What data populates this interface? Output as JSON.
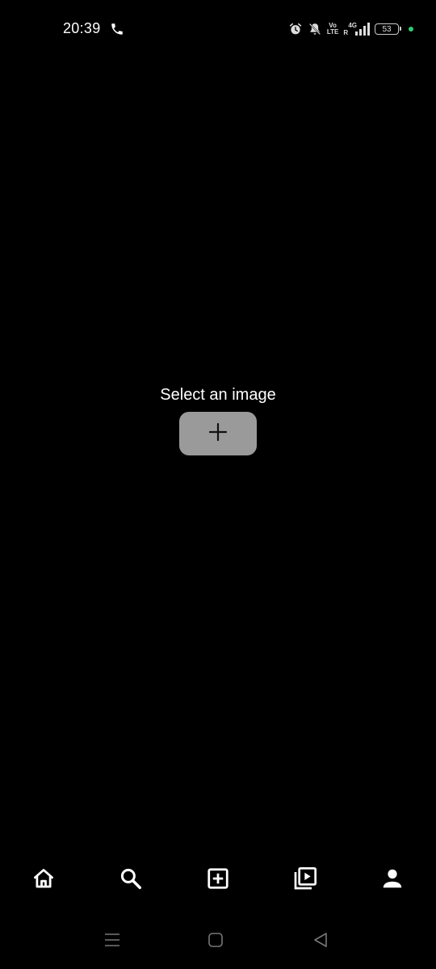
{
  "status_bar": {
    "time": "20:39",
    "volte_top": "Vo",
    "volte_bottom": "LTE",
    "network_top": "4G",
    "network_bottom": "R",
    "battery_level": "53",
    "icons": [
      "call-icon",
      "alarm-icon",
      "bell-off-icon",
      "signal-icon",
      "battery-icon"
    ],
    "dot_color": "#2ecc71"
  },
  "main": {
    "prompt": "Select an image",
    "add_button_icon": "plus-icon",
    "add_button_color": "#9a9a9a"
  },
  "bottom_nav": {
    "items": [
      {
        "name": "home",
        "icon": "home-icon"
      },
      {
        "name": "search",
        "icon": "search-icon"
      },
      {
        "name": "add-post",
        "icon": "plus-square-icon"
      },
      {
        "name": "reels",
        "icon": "video-library-icon"
      },
      {
        "name": "profile",
        "icon": "person-icon"
      }
    ]
  },
  "system_nav": {
    "items": [
      "menu-icon",
      "home-square-icon",
      "back-triangle-icon"
    ]
  },
  "colors": {
    "background": "#000000",
    "foreground": "#ffffff"
  }
}
